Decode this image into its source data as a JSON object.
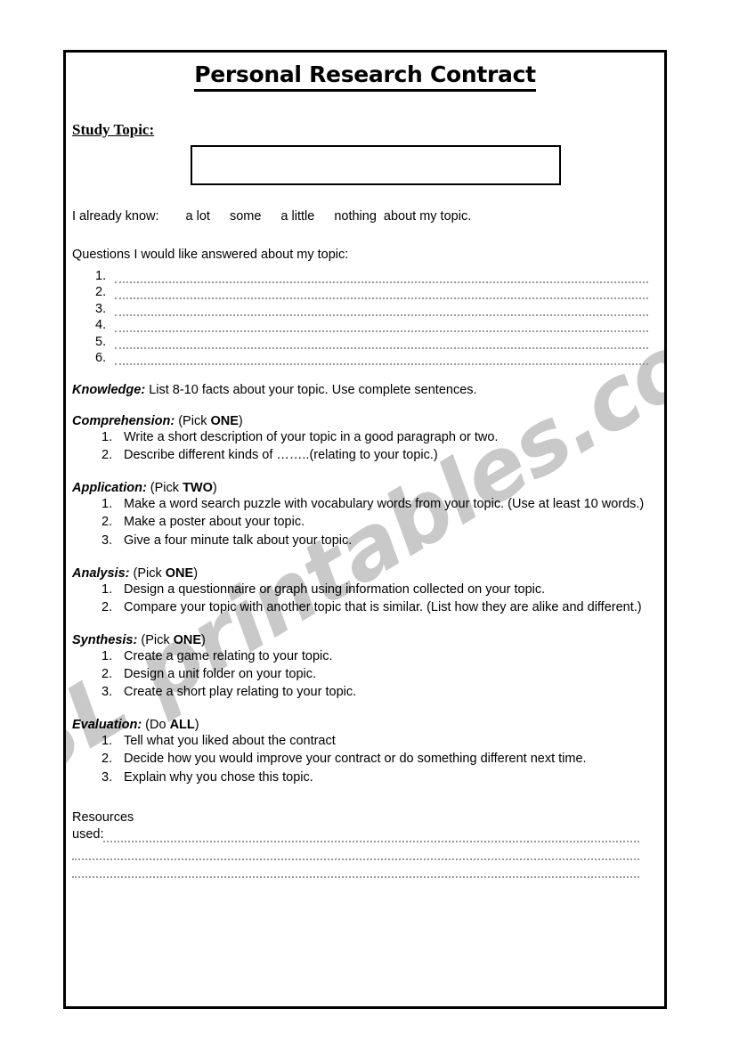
{
  "document": {
    "title": "Personal Research Contract",
    "watermark": "ESL printables.com"
  },
  "study_topic": {
    "label": "Study Topic:",
    "input_value": "",
    "input_placeholder": ""
  },
  "already_know": {
    "label": "I already know:",
    "options": [
      "a lot",
      "some",
      "a little",
      "nothing"
    ],
    "suffix": "about my topic."
  },
  "questions": {
    "heading": "Questions I would like answered about my topic:",
    "numbers": [
      "1.",
      "2.",
      "3.",
      "4.",
      "5.",
      "6."
    ],
    "values": [
      "",
      "",
      "",
      "",
      "",
      ""
    ]
  },
  "sections": [
    {
      "name": "Knowledge:",
      "instruction": " List 8-10 facts about your topic. Use complete sentences.",
      "pick_prefix": "",
      "pick_strong": "",
      "pick_suffix": "",
      "items": []
    },
    {
      "name": "Comprehension:",
      "instruction": "",
      "pick_prefix": " (Pick ",
      "pick_strong": "ONE",
      "pick_suffix": ")",
      "items": [
        {
          "num": "1.",
          "text": "Write a short description of your topic in a good paragraph or two."
        },
        {
          "num": "2.",
          "text": "Describe different kinds of ……..(relating to your topic.)"
        }
      ]
    },
    {
      "name": "Application:",
      "instruction": "",
      "pick_prefix": " (Pick ",
      "pick_strong": "TWO",
      "pick_suffix": ")",
      "items": [
        {
          "num": "1.",
          "text": "Make a word search puzzle with vocabulary words from your topic. (Use at least 10 words.)"
        },
        {
          "num": "2.",
          "text": "Make a poster about your topic."
        },
        {
          "num": "3.",
          "text": "Give a four minute talk about your topic."
        }
      ]
    },
    {
      "name": "Analysis:",
      "instruction": "",
      "pick_prefix": " (Pick ",
      "pick_strong": "ONE",
      "pick_suffix": ")",
      "items": [
        {
          "num": "1.",
          "text": "Design a questionnaire or graph using information collected on your topic."
        },
        {
          "num": "2.",
          "text": "Compare your topic with another topic that is similar. (List how they are alike and different.)"
        }
      ]
    },
    {
      "name": "Synthesis:",
      "instruction": "",
      "pick_prefix": " (Pick ",
      "pick_strong": "ONE",
      "pick_suffix": ")",
      "items": [
        {
          "num": "1.",
          "text": "Create a game relating to your topic."
        },
        {
          "num": "2.",
          "text": "Design a unit folder on your topic."
        },
        {
          "num": "3.",
          "text": "Create a short play relating to your topic."
        }
      ]
    },
    {
      "name": "Evaluation:",
      "instruction": "",
      "pick_prefix": " (Do ",
      "pick_strong": "ALL",
      "pick_suffix": ")",
      "items": [
        {
          "num": "1.",
          "text": "Tell what you liked about the contract"
        },
        {
          "num": "2.",
          "text": "Decide how you would improve your contract or do something different next time."
        },
        {
          "num": "3.",
          "text": "Explain why you chose this topic."
        }
      ]
    }
  ],
  "resources": {
    "word": "Resources",
    "used_label": "used:",
    "values": [
      "",
      "",
      ""
    ]
  }
}
